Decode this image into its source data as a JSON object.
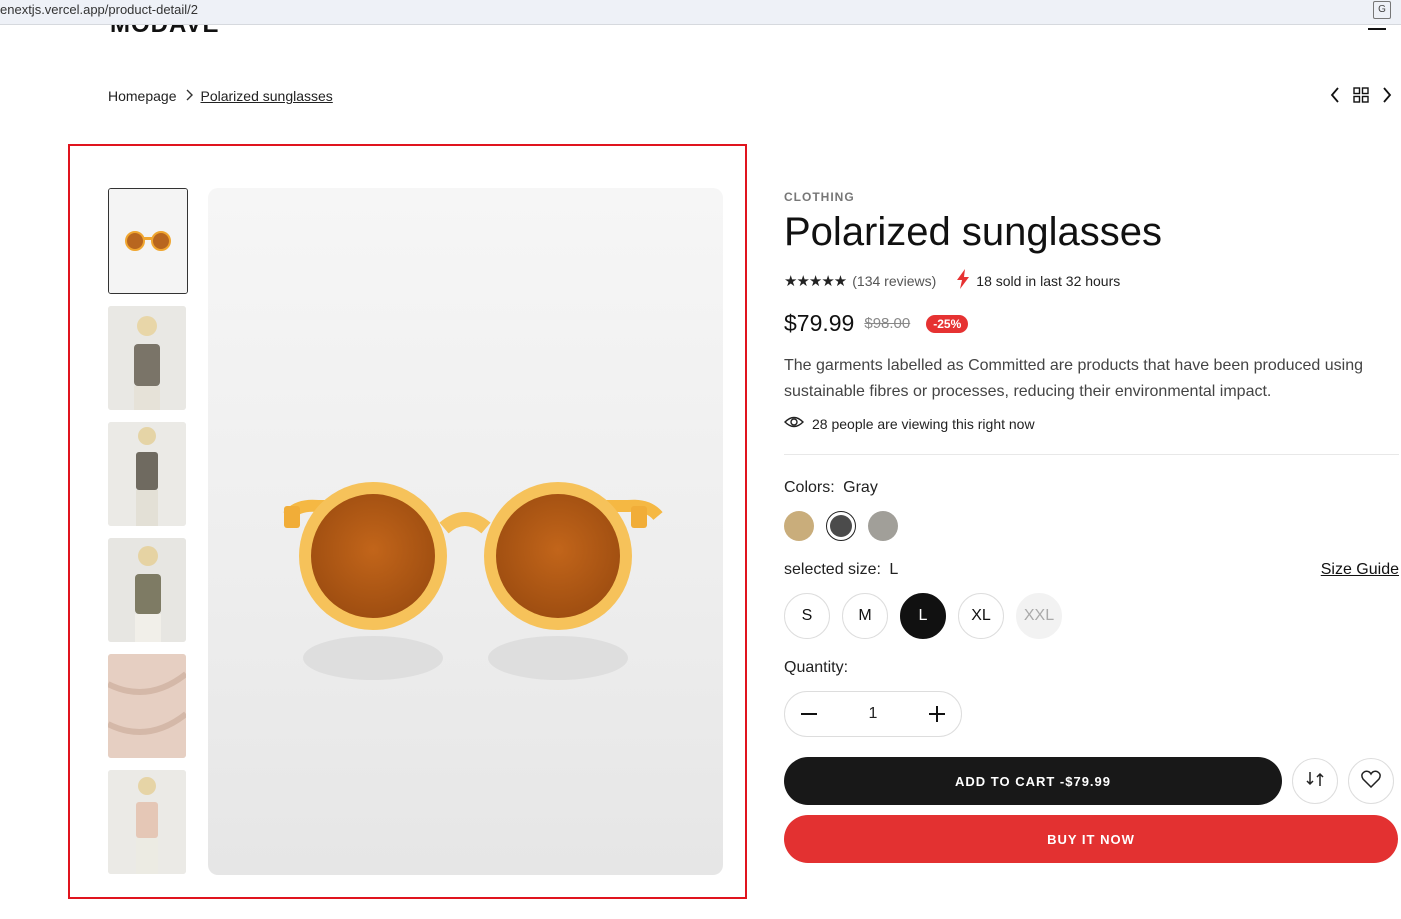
{
  "browser": {
    "url": "enextjs.vercel.app/product-detail/2"
  },
  "breadcrumb": {
    "home": "Homepage",
    "current": "Polarized sunglasses"
  },
  "product": {
    "category": "CLOTHING",
    "title": "Polarized sunglasses",
    "rating_stars": "★★★★★",
    "reviews": "(134 reviews)",
    "sold_text": "18 sold in last 32 hours",
    "price": "$79.99",
    "old_price": "$98.00",
    "discount": "-25%",
    "description": "The garments labelled as Committed are products that have been produced using sustainable fibres or processes, reducing their environmental impact.",
    "viewing": "28 people are viewing this right now",
    "colors_label": "Colors:",
    "selected_color": "Gray",
    "colors": [
      "#c9ad7b",
      "#4b4b4b",
      "#a19f99"
    ],
    "size_label": "selected size:",
    "selected_size": "L",
    "size_guide": "Size Guide",
    "sizes": [
      "S",
      "M",
      "L",
      "XL",
      "XXL"
    ],
    "quantity_label": "Quantity:",
    "quantity": "1",
    "add_to_cart": "ADD TO CART -$79.99",
    "buy_now": "BUY IT NOW"
  }
}
